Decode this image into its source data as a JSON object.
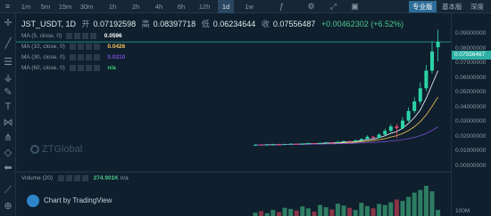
{
  "toolbar": {
    "timeframes": [
      "1m",
      "5m",
      "15m",
      "30m",
      "1h",
      "2h",
      "4h",
      "6h",
      "12h",
      "1d",
      "1w"
    ],
    "active_timeframe": "1d",
    "languages": [
      {
        "label": "专业版",
        "active": true
      },
      {
        "label": "基本版",
        "active": false
      },
      {
        "label": "深度图",
        "active": false
      }
    ]
  },
  "legend": {
    "symbol": "JST_USDT, 1D",
    "open_label": "开",
    "open": "0.07192598",
    "high_label": "高",
    "high": "0.08397718",
    "low_label": "低",
    "low": "0.06234644",
    "close_label": "收",
    "close": "0.07556487",
    "change": "+0.00462302 (+6.52%)"
  },
  "indicators": [
    {
      "label": "MA (5, close, 0)",
      "value": "0.0596",
      "color": "#ffffff"
    },
    {
      "label": "MA (10, close, 0)",
      "value": "0.0426",
      "color": "#f5c35a"
    },
    {
      "label": "MA (30, close, 0)",
      "value": "0.0210",
      "color": "#7a4fd6"
    },
    {
      "label": "MA (60, close, 0)",
      "value": "n/a",
      "color": "#3ccf70"
    }
  ],
  "watermark": "ZTGlobal",
  "volume": {
    "label": "Volume (20)",
    "value": "274.901K",
    "extra": "n/a",
    "axis_label": "100M"
  },
  "brand": "Chart by TradingView",
  "price_axis": {
    "labels": [
      "0.09000000",
      "0.08000000",
      "0.07000000",
      "0.06000000",
      "0.05000000",
      "0.04000000",
      "0.03000000",
      "0.02000000",
      "0.01000000",
      "0.00000000"
    ],
    "current": "0.07556487"
  },
  "chart_data": {
    "type": "candlestick",
    "ylim": [
      0,
      0.095
    ],
    "closes": [
      0.0055,
      0.0055,
      0.0057,
      0.0058,
      0.0056,
      0.006,
      0.0062,
      0.0059,
      0.0063,
      0.0066,
      0.0064,
      0.0068,
      0.0072,
      0.007,
      0.0075,
      0.008,
      0.0078,
      0.0086,
      0.0095,
      0.011,
      0.0102,
      0.0125,
      0.015,
      0.018,
      0.0168,
      0.022,
      0.0285,
      0.035,
      0.044,
      0.056,
      0.069,
      0.0756
    ],
    "opens": [
      0.0052,
      0.0056,
      0.0054,
      0.0057,
      0.0058,
      0.0056,
      0.006,
      0.0062,
      0.0059,
      0.0063,
      0.0066,
      0.0064,
      0.0068,
      0.0072,
      0.007,
      0.0075,
      0.008,
      0.0078,
      0.0086,
      0.0095,
      0.011,
      0.0102,
      0.0125,
      0.015,
      0.018,
      0.0168,
      0.022,
      0.0285,
      0.035,
      0.044,
      0.056,
      0.0719
    ],
    "highs": [
      0.006,
      0.006,
      0.006,
      0.0062,
      0.0062,
      0.0063,
      0.0066,
      0.0064,
      0.0066,
      0.007,
      0.0069,
      0.0071,
      0.0076,
      0.0076,
      0.008,
      0.0085,
      0.0084,
      0.009,
      0.01,
      0.012,
      0.0118,
      0.0135,
      0.0165,
      0.0195,
      0.02,
      0.0245,
      0.031,
      0.038,
      0.048,
      0.06,
      0.076,
      0.084
    ],
    "lows": [
      0.005,
      0.0052,
      0.0052,
      0.0054,
      0.0054,
      0.0055,
      0.0058,
      0.0057,
      0.0057,
      0.0061,
      0.0062,
      0.0062,
      0.0066,
      0.0068,
      0.0068,
      0.0072,
      0.0074,
      0.0076,
      0.0083,
      0.009,
      0.0095,
      0.01,
      0.012,
      0.014,
      0.01,
      0.016,
      0.021,
      0.027,
      0.033,
      0.042,
      0.054,
      0.0623
    ],
    "volumes": [
      12,
      18,
      10,
      22,
      14,
      30,
      26,
      20,
      35,
      28,
      16,
      40,
      32,
      24,
      45,
      38,
      30,
      22,
      48,
      36,
      28,
      44,
      40,
      50,
      60,
      55,
      70,
      85,
      95,
      110,
      90,
      22
    ]
  }
}
